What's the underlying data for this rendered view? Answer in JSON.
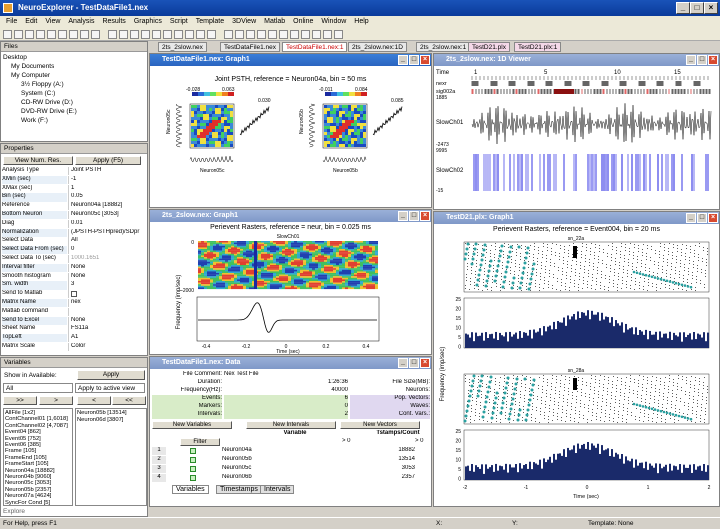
{
  "app": {
    "title": "NeuroExplorer - TestDataFile1.nex"
  },
  "menu": [
    "File",
    "Edit",
    "View",
    "Analysis",
    "Results",
    "Graphics",
    "Script",
    "Template",
    "3DView",
    "Matlab",
    "Online",
    "Window",
    "Help"
  ],
  "doc_tabs": [
    {
      "label": "2ts_2slow.nex",
      "style": "normal"
    },
    {
      "label": "TestDataFile1.nex",
      "style": "normal"
    },
    {
      "label": "TestDataFile1.nex:1",
      "style": "sel"
    },
    {
      "label": "2ts_2slow.nex:1D",
      "style": "normal"
    },
    {
      "label": "2ts_2slow.nex:1",
      "style": "normal"
    },
    {
      "label": "TestD21.plx",
      "style": "pink"
    },
    {
      "label": "TestD21.plx:1",
      "style": "pink"
    }
  ],
  "files": {
    "header": "Files",
    "items": [
      "Desktop",
      "My Documents",
      "My Computer",
      "3½ Floppy (A:)",
      "System (C:)",
      "CD-RW Drive (D:)",
      "DVD-RW Drive (E:)",
      "Work (F:)"
    ]
  },
  "properties": {
    "header": "Properties",
    "col_button": "View Num. Res.",
    "apply_button": "Apply (F5)",
    "rows": [
      [
        "Analysis Type",
        "Joint PSTH"
      ],
      [
        "XMin (sec)",
        "-1"
      ],
      [
        "XMax (sec)",
        "1"
      ],
      [
        "Bin (sec)",
        "0.05"
      ],
      [
        "Reference",
        "Neuron04a [18882]"
      ],
      [
        "Bottom Neuron",
        "Neuron05c [3053]"
      ],
      [
        "Diag",
        "0.01"
      ],
      [
        "Normalization",
        "(JPSTH-PSTHpred)/SDpr"
      ],
      [
        "Select Data",
        "All"
      ],
      [
        "Select Data From (sec)",
        "0"
      ],
      [
        "Select Data To (sec)",
        "1000.1651"
      ],
      [
        "Interval filter",
        "None"
      ],
      [
        "Smooth histogram",
        "None"
      ],
      [
        "Sm. width",
        "3"
      ],
      [
        "Send to Matlab",
        ""
      ],
      [
        "Matrix Name",
        "nex"
      ],
      [
        "Matlab command",
        ""
      ],
      [
        "Send to Excel",
        "None"
      ],
      [
        "Sheet Name",
        "FS11a"
      ],
      [
        "TopLeft",
        "A1"
      ],
      [
        "Matrix Scale",
        "Color"
      ]
    ]
  },
  "variables": {
    "header": "Variables",
    "show_label": "Show in Available:",
    "apply_label": "Apply",
    "filter_value": "All",
    "apply_active": "Apply to active view",
    "left_list": [
      "AllFile [1x2]",
      "ContChannel01 [1,6018]",
      "ContChannel02 [4,7087]",
      "Event04 [862]",
      "Event05 [752]",
      "Event06 [385]",
      "Frame [105]",
      "FrameEnd [105]",
      "FrameStart [105]",
      "Neuron04a [18882]",
      "Neuron04b [9060]",
      "Neuron05c [3053]",
      "Neuron05b [2357]",
      "Neuron07a [4624]",
      "SyncFor Cond [5]"
    ],
    "right_list": [
      "Neuron05b [13514]",
      "Neuron06d [3807]"
    ],
    "explore": "Explore"
  },
  "win_jpsth": {
    "title": "TestDataFile1.nex: Graph1",
    "plot_title": "Joint PSTH, reference = Neuron04a, bin = 50 ms",
    "left": {
      "vmin": "-0.028",
      "vmax": "0.063",
      "xlabel": "Neuron05c",
      "ylabel": "Neuron05c"
    },
    "right": {
      "vmin": "-0.011",
      "vmax": "0.084",
      "xlabel": "Neuron05b",
      "ylabel": "Neuron05b"
    },
    "diag_left": "0.030",
    "diag_right": "0.085"
  },
  "win_1d": {
    "title": "2ts_2slow.nex: 1D Viewer",
    "time_label": "Time",
    "ticks": [
      "1",
      "5",
      "10",
      "15"
    ],
    "channels": [
      "nexr",
      "sig002a",
      "SlowCh01",
      "SlowCh02"
    ],
    "vals": [
      "1885",
      "-2473",
      "9995",
      "-15"
    ]
  },
  "win_perievent": {
    "title": "2ts_2slow.nex: Graph1",
    "plot_title": "Perievent Rasters, reference = neur, bin = 0.025 ms",
    "panel_label": "SlowCh01",
    "ylabel": "Frequency (imp/sec)",
    "xlabel": "Time (sec)",
    "y_top": "0",
    "y_bottom": "-2000",
    "x_ticks": [
      "-0.4",
      "-0.2",
      "0",
      "0.2",
      "0.4"
    ]
  },
  "win_test21": {
    "title": "TestD21.plx: Graph1",
    "plot_title": "Perievent Rasters, reference = Event004, bin = 20 ms",
    "ylabel": "Frequency (imp/sec)",
    "xlabel": "Time (sec)",
    "top_label": "sn_22a",
    "mid_label": "sn_28a",
    "y_ticks_top": [
      "25",
      "20",
      "15",
      "10",
      "5",
      "0"
    ],
    "y_ticks_bot": [
      "25",
      "20",
      "15",
      "10",
      "5",
      "0"
    ],
    "x_ticks": [
      "-2",
      "-1",
      "0",
      "1",
      "2"
    ]
  },
  "win_data": {
    "title": "TestDataFile1.nex: Data",
    "info_left": [
      [
        "File Comment:",
        "Nex Test File"
      ],
      [
        "Duration:",
        "1:26:36"
      ],
      [
        "Frequency(Hz):",
        "40000"
      ],
      [
        "Events:",
        "6"
      ],
      [
        "Markers:",
        "0"
      ],
      [
        "Intervals:",
        "2"
      ]
    ],
    "info_right": [
      [
        "File Size(MB):",
        ""
      ],
      [
        "Neurons:",
        ""
      ],
      [
        "Pop. Vectors:",
        ""
      ],
      [
        "Waves:",
        ""
      ],
      [
        "Cont. Vars.:",
        ""
      ]
    ],
    "buttons": [
      "New Variables",
      "New Intervals",
      "New Vectors"
    ],
    "filter": "Filter",
    "col_variable": "Variable",
    "col_ts": "Tstamps/Count",
    "cmp1": "> 0",
    "cmp2": "> 0",
    "rows": [
      [
        "1",
        "Neuron04a",
        "18882"
      ],
      [
        "2",
        "Neuron05b",
        "13514"
      ],
      [
        "3",
        "Neuron05c",
        "3053"
      ],
      [
        "4",
        "Neuron06b",
        "2357"
      ]
    ],
    "tabs": [
      "Variables",
      "Timestamps",
      "Intervals"
    ]
  },
  "status": {
    "help": "For Help, press F1",
    "x": "X:",
    "y": "Y:",
    "template": "Template: None"
  }
}
